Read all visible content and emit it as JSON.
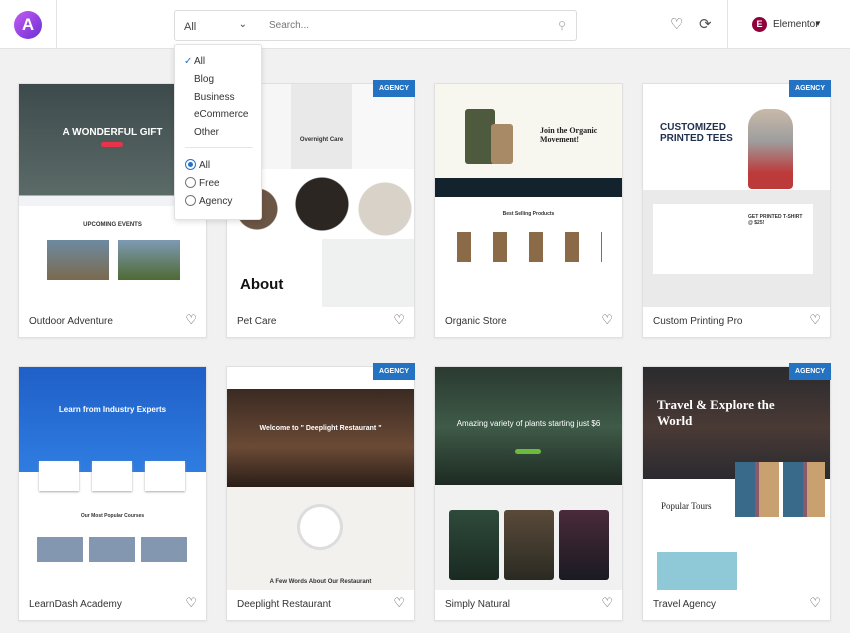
{
  "header": {
    "logo_letter": "A",
    "filter": {
      "selected": "All",
      "chevron": "chevron-down-icon"
    },
    "search": {
      "placeholder": "Search...",
      "icon": "search-icon"
    },
    "favorites_icon": "heart-icon",
    "sync_icon": "refresh-icon",
    "builder": {
      "icon_letter": "E",
      "label": "Elementor",
      "caret": "▼"
    }
  },
  "dropdown": {
    "categories": [
      "All",
      "Blog",
      "Business",
      "eCommerce",
      "Other"
    ],
    "selected_category": "All",
    "types": [
      "All",
      "Free",
      "Agency"
    ],
    "selected_type": "All"
  },
  "colors": {
    "accent": "#2473c2",
    "badge": "#2473c2",
    "elementor": "#92003b"
  },
  "cards": [
    {
      "title": "Outdoor Adventure",
      "badge": "",
      "headline": "A WONDERFUL GIFT",
      "sub": "UPCOMING EVENTS"
    },
    {
      "title": "Pet Care",
      "badge": "AGENCY",
      "headline": "About",
      "sub": "Overnight Care"
    },
    {
      "title": "Organic Store",
      "badge": "",
      "headline": "Join the Organic Movement!",
      "sub": "Best Selling Products"
    },
    {
      "title": "Custom Printing Pro",
      "badge": "AGENCY",
      "headline": "CUSTOMIZED PRINTED TEES",
      "sub": "GET PRINTED T-SHIRT @ $25!"
    },
    {
      "title": "LearnDash Academy",
      "badge": "",
      "headline": "Learn from Industry Experts",
      "sub": "Our Most Popular Courses"
    },
    {
      "title": "Deeplight Restaurant",
      "badge": "AGENCY",
      "headline": "Welcome to \" Deeplight Restaurant \"",
      "sub": "A Few Words About Our Restaurant"
    },
    {
      "title": "Simply Natural",
      "badge": "",
      "headline": "Amazing variety of plants starting just $6",
      "sub": ""
    },
    {
      "title": "Travel Agency",
      "badge": "AGENCY",
      "headline": "Travel & Explore the World",
      "sub": "Popular Tours"
    }
  ]
}
